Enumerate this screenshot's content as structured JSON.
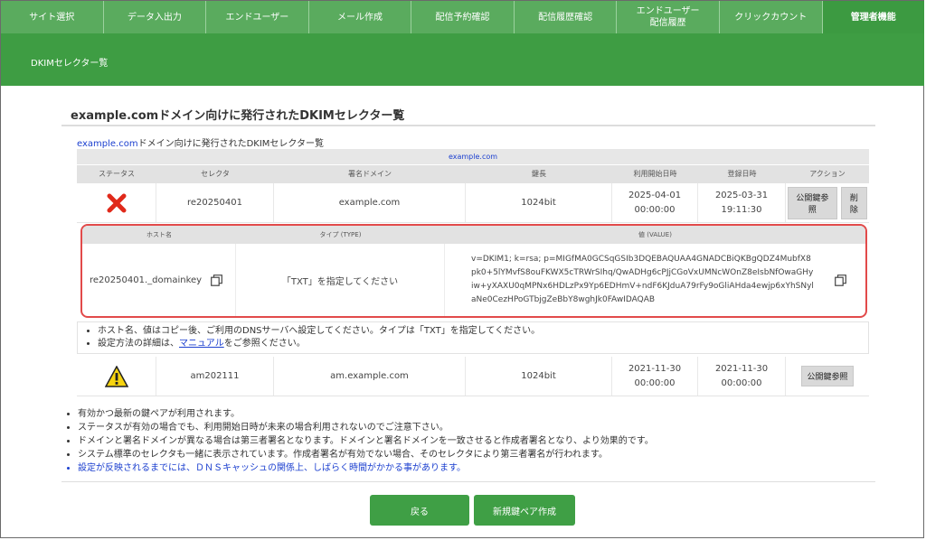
{
  "nav": {
    "items": [
      {
        "label": "サイト選択"
      },
      {
        "label": "データ入出力"
      },
      {
        "label": "エンドユーザー"
      },
      {
        "label": "メール作成"
      },
      {
        "label": "配信予約確認"
      },
      {
        "label": "配信履歴確認"
      },
      {
        "label": "エンドユーザー\n配信履歴"
      },
      {
        "label": "クリックカウント"
      },
      {
        "label": "管理者機能",
        "active": true
      }
    ]
  },
  "subbar": {
    "title": "DKIMセレクター覧"
  },
  "page": {
    "heading": "example.comドメイン向けに発行されたDKIMセレクター覧",
    "caption_domain": "example.com",
    "caption_rest": "ドメイン向けに発行されたDKIMセレクター覧"
  },
  "table": {
    "domain_header": "example.com",
    "columns": [
      "ステータス",
      "セレクタ",
      "署名ドメイン",
      "鍵長",
      "利用開始日時",
      "登録日時",
      "アクション"
    ],
    "rows": [
      {
        "status_icon": "red-x-icon",
        "selector": "re20250401",
        "domain": "example.com",
        "key_length": "1024bit",
        "start": "2025-04-01\n00:00:00",
        "registered": "2025-03-31\n19:11:30",
        "btn_view": "公開鍵参照",
        "btn_delete": "削除"
      },
      {
        "status_icon": "warning-icon",
        "selector": "am202111",
        "domain": "am.example.com",
        "key_length": "1024bit",
        "start": "2021-11-30\n00:00:00",
        "registered": "2021-11-30\n00:00:00",
        "btn_view": "公開鍵参照"
      }
    ]
  },
  "dns": {
    "columns": [
      "ホスト名",
      "タイプ (TYPE)",
      "値 (VALUE)"
    ],
    "host": "re20250401._domainkey",
    "type": "「TXT」を指定してください",
    "value": "v=DKIM1; k=rsa; p=MIGfMA0GCSqGSIb3DQEBAQUAA4GNADCBiQKBgQDZ4MubfX8pk0+5lYMvfS8ouFKWX5cTRWrSIhq/QwADHg6cPJjCGoVxUMNcWOnZ8eIsbNfOwaGHyiw+yXAXU0qMPNx6HDLzPx9Yp6EDHmV+ndF6KJduA79rFy9oGliAHda4ewjp6xYhSNylaNe0CezHPoGTbjgZeBbY8wghJk0FAwIDAQAB"
  },
  "notes": {
    "line1": "ホスト名、値はコピー後、ご利用のDNSサーバへ設定してください。タイプは「TXT」を指定してください。",
    "line2_pre": "設定方法の詳細は、",
    "line2_link": "マニュアル",
    "line2_post": "をご参照ください。"
  },
  "bottom_notes": [
    "有効かつ最新の鍵ペアが利用されます。",
    "ステータスが有効の場合でも、利用開始日時が未来の場合利用されないのでご注意下さい。",
    "ドメインと署名ドメインが異なる場合は第三者署名となります。ドメインと署名ドメインを一致させると作成者署名となり、より効果的です。",
    "システム標準のセレクタも一緒に表示されています。作成者署名が有効でない場合、そのセレクタにより第三者署名が行われます。",
    "設定が反映されるまでには、ＤＮＳキャッシュの関係上、しばらく時間がかかる事があります。"
  ],
  "buttons": {
    "back": "戻る",
    "new_keypair": "新規鍵ペア作成"
  },
  "colors": {
    "nav_green": "#5aab5e",
    "active_green": "#3c9a41",
    "link_blue": "#1b3fcf",
    "error_red": "#e0291a",
    "highlight_border": "#e24a4a"
  }
}
